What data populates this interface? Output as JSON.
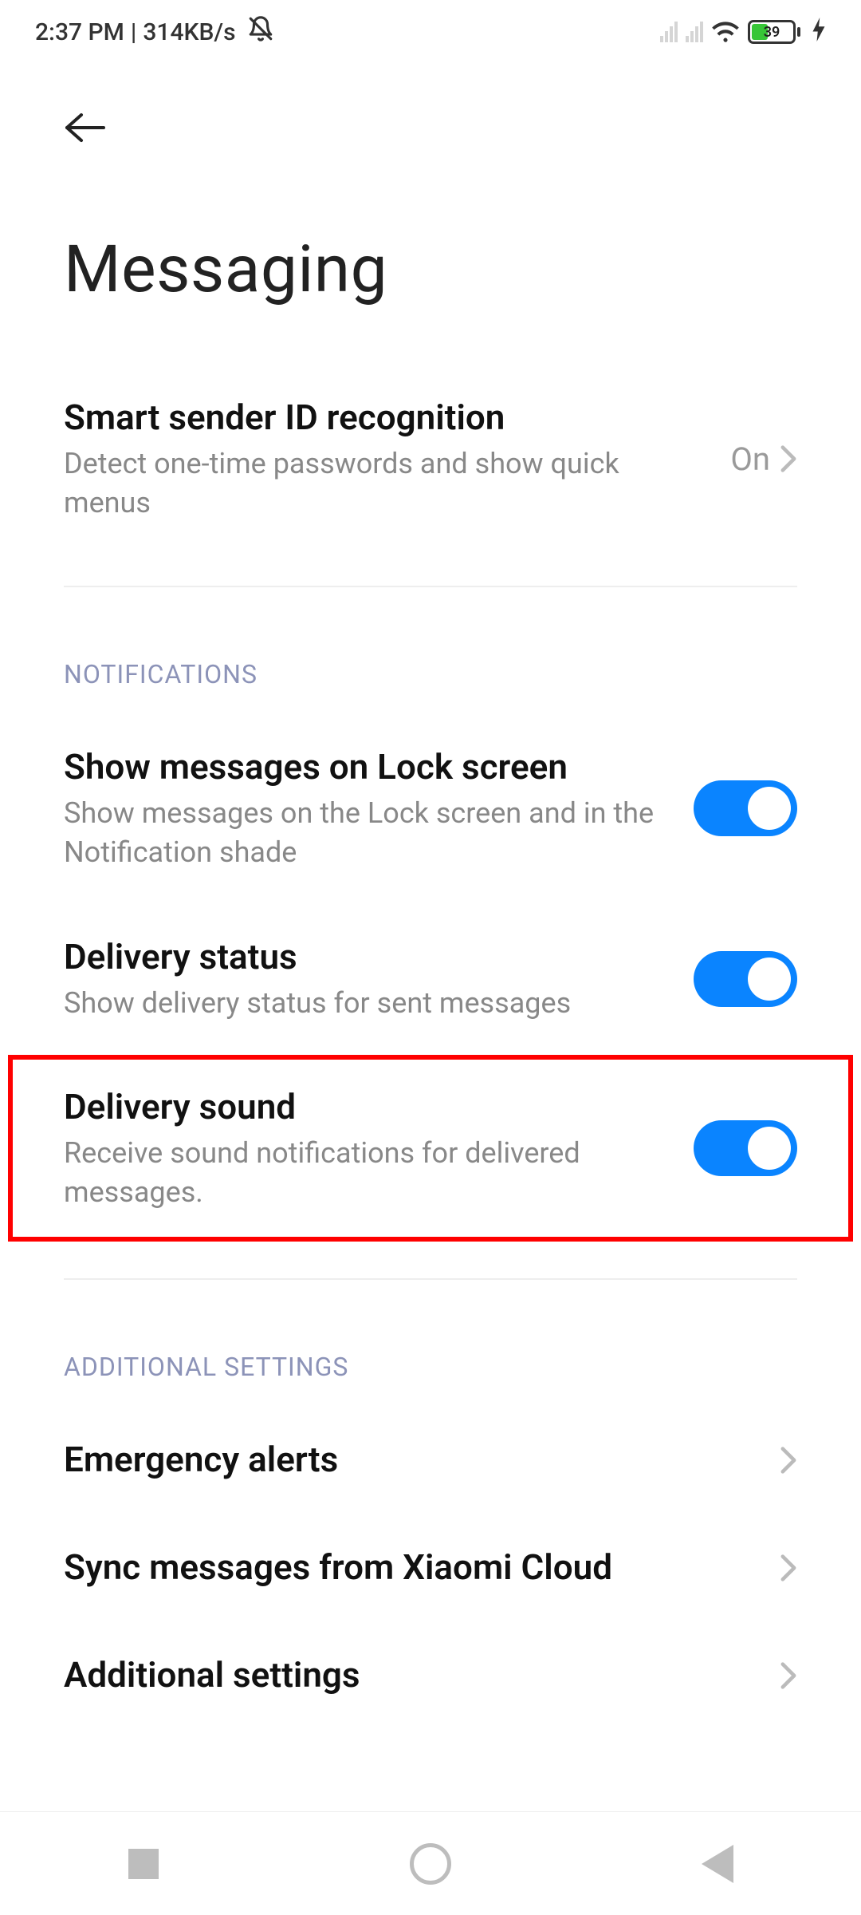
{
  "status": {
    "time": "2:37 PM",
    "sep": "|",
    "net_speed": "314KB/s",
    "dnd_icon": "bell-slash-icon",
    "battery_percent": "39"
  },
  "header": {
    "title": "Messaging"
  },
  "smart_sender": {
    "title": "Smart sender ID recognition",
    "sub": "Detect one-time passwords and show quick menus",
    "value": "On"
  },
  "sections": {
    "notifications_header": "NOTIFICATIONS",
    "additional_header": "ADDITIONAL SETTINGS"
  },
  "lock_screen": {
    "title": "Show messages on Lock screen",
    "sub": "Show messages on the Lock screen and in the Notification shade",
    "on": true
  },
  "delivery_status": {
    "title": "Delivery status",
    "sub": "Show delivery status for sent messages",
    "on": true
  },
  "delivery_sound": {
    "title": "Delivery sound",
    "sub": "Receive sound notifications for delivered messages.",
    "on": true
  },
  "additional": {
    "emergency": "Emergency alerts",
    "sync": "Sync messages from Xiaomi Cloud",
    "more": "Additional settings"
  }
}
